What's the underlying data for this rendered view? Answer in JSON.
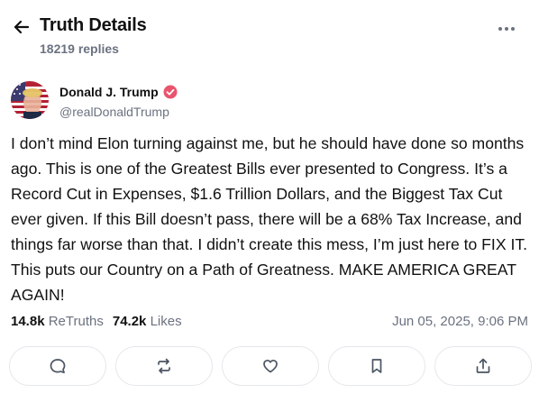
{
  "header": {
    "title": "Truth Details",
    "replies": "18219 replies"
  },
  "post": {
    "author": "Donald J. Trump",
    "handle": "@realDonaldTrump",
    "verified": true,
    "body": "I don’t mind Elon turning against me, but he should have done so months ago. This is one of the Greatest Bills ever presented to Congress. It’s a Record Cut in Expenses, $1.6 Trillion Dollars, and the Biggest Tax Cut ever given. If this Bill doesn’t pass, there will be a 68% Tax Increase, and things far worse than that. I didn’t create this mess, I’m just here to FIX IT. This puts our Country on a Path of Greatness. MAKE AMERICA GREAT AGAIN!",
    "retruths_count": "14.8k",
    "retruths_label": "ReTruths",
    "likes_count": "74.2k",
    "likes_label": "Likes",
    "timestamp": "Jun 05, 2025, 9:06 PM"
  },
  "actions": [
    "reply-icon",
    "retruth-icon",
    "like-icon",
    "bookmark-icon",
    "share-icon"
  ],
  "colors": {
    "text": "#111111",
    "muted": "#6b7280",
    "border": "#e5e7eb",
    "verified_badge": "#e8556c"
  }
}
